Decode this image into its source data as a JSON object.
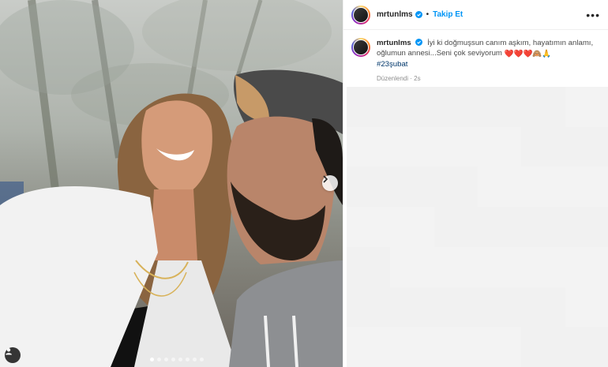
{
  "post": {
    "header": {
      "username": "mrtunlms",
      "separator": "•",
      "follow_label": "Takip Et",
      "more_label": "•••"
    },
    "caption": {
      "username": "mrtunlms",
      "text": "İyi ki doğmuşsun canım aşkım, hayatımın anlamı, oğlumun annesi...Seni çok seviyorum",
      "emojis": "❤️❤️❤️🙈🙏",
      "hashtag": "#23şubat",
      "edited_label": "Düzenlendi",
      "time_label": "2s"
    },
    "carousel": {
      "slide_count": 8,
      "active_slide": 1
    }
  },
  "colors": {
    "follow": "#0095f6",
    "hashtag": "#00376b",
    "verified": "#0095f6",
    "heart": "#e0245e"
  }
}
